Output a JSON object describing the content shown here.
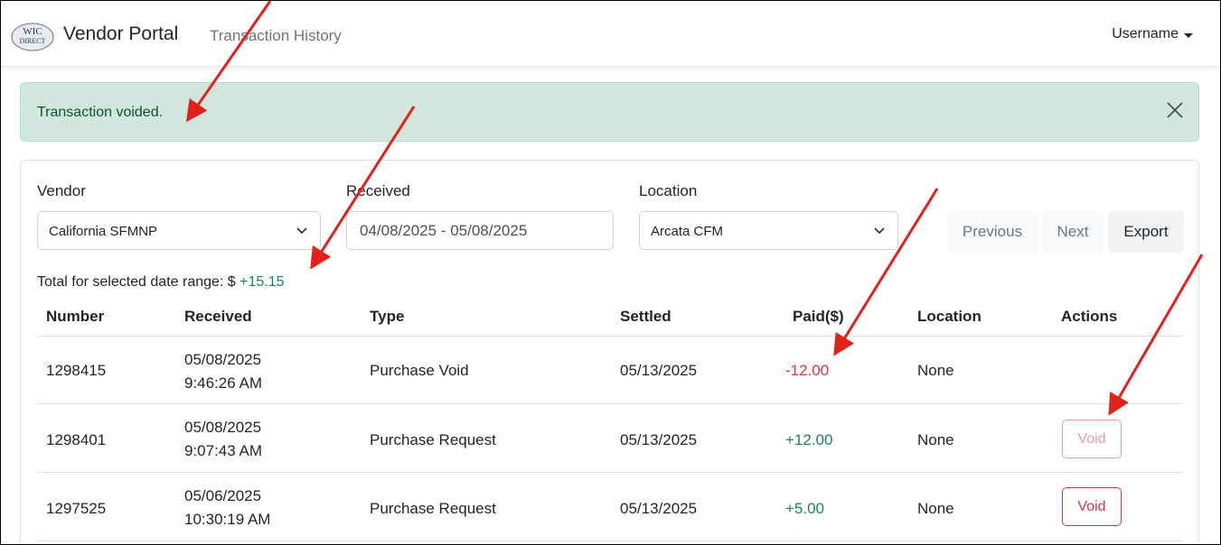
{
  "navbar": {
    "brand": "Vendor Portal",
    "nav_link": "Transaction History",
    "user": "Username",
    "logo_text_top": "WIC",
    "logo_text_bottom": "DIRECT"
  },
  "alert": {
    "message": "Transaction voided.",
    "close_icon": "close-icon"
  },
  "filters": {
    "vendor": {
      "label": "Vendor",
      "value": "California SFMNP"
    },
    "received": {
      "label": "Received",
      "value": "04/08/2025 - 05/08/2025"
    },
    "location": {
      "label": "Location",
      "value": "Arcata CFM"
    }
  },
  "buttons": {
    "previous": "Previous",
    "next": "Next",
    "export": "Export"
  },
  "total": {
    "label": "Total for selected date range: $",
    "value": "+15.15"
  },
  "table": {
    "headers": [
      "Number",
      "Received",
      "Type",
      "Settled",
      "Paid($)",
      "Location",
      "Actions"
    ],
    "rows": [
      {
        "number": "1298415",
        "received_date": "05/08/2025",
        "received_time": "9:46:26 AM",
        "type": "Purchase Void",
        "settled": "05/13/2025",
        "paid": "-12.00",
        "location": "None",
        "action": ""
      },
      {
        "number": "1298401",
        "received_date": "05/08/2025",
        "received_time": "9:07:43 AM",
        "type": "Purchase Request",
        "settled": "05/13/2025",
        "paid": "+12.00",
        "location": "None",
        "action": "Void"
      },
      {
        "number": "1297525",
        "received_date": "05/06/2025",
        "received_time": "10:30:19 AM",
        "type": "Purchase Request",
        "settled": "05/13/2025",
        "paid": "+5.00",
        "location": "None",
        "action": "Void"
      }
    ]
  },
  "colors": {
    "success": "#198754",
    "danger": "#dc3545",
    "alert_bg": "#d1e7dd",
    "annotation_arrow": "#e3211c"
  }
}
